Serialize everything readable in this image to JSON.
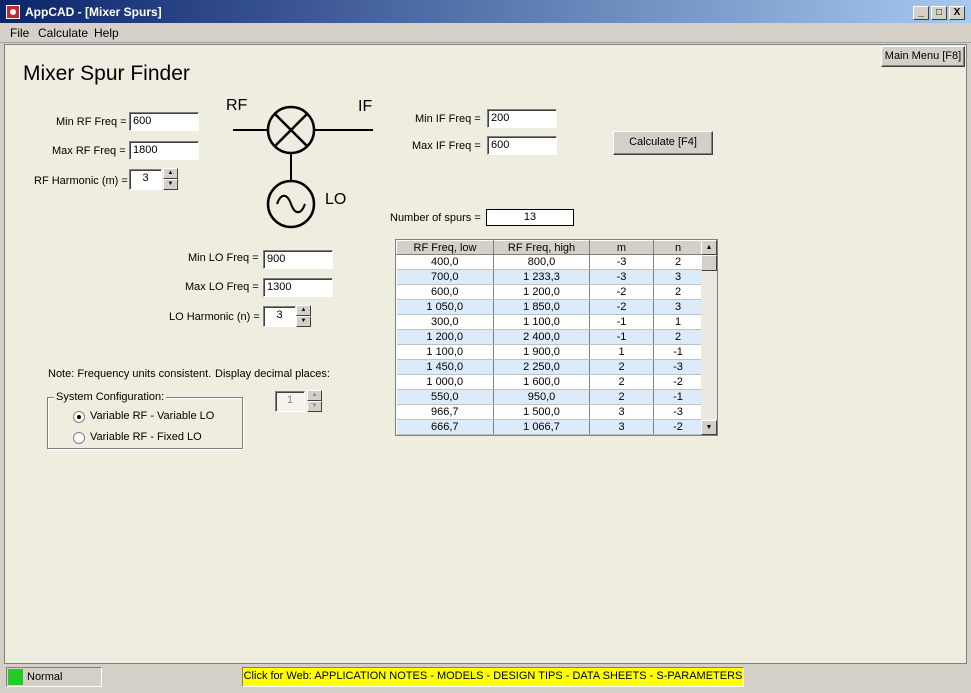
{
  "window": {
    "title": "AppCAD - [Mixer Spurs]",
    "btn_min": "_",
    "btn_max": "□",
    "btn_close": "X"
  },
  "menu": {
    "file": "File",
    "calculate": "Calculate",
    "help": "Help"
  },
  "main_menu_button": "Main Menu [F8]",
  "page_title": "Mixer Spur Finder",
  "rf": {
    "min_label": "Min RF Freq =",
    "min_value": "600",
    "max_label": "Max RF Freq =",
    "max_value": "1800",
    "harmonic_label": "RF Harmonic (m) =",
    "harmonic_value": "3"
  },
  "if": {
    "min_label": "Min IF Freq =",
    "min_value": "200",
    "max_label": "Max IF Freq =",
    "max_value": "600"
  },
  "lo": {
    "min_label": "Min LO Freq =",
    "min_value": "900",
    "max_label": "Max LO Freq =",
    "max_value": "1300",
    "harmonic_label": "LO Harmonic (n) =",
    "harmonic_value": "3"
  },
  "diagram": {
    "rf": "RF",
    "if": "IF",
    "lo": "LO"
  },
  "calculate_button": "Calculate  [F4]",
  "spurs": {
    "label": "Number of spurs =",
    "value": "13"
  },
  "table": {
    "headers": [
      "RF Freq, low",
      "RF Freq, high",
      "m",
      "n"
    ],
    "rows": [
      [
        "400,0",
        "800,0",
        "-3",
        "2"
      ],
      [
        "700,0",
        "1 233,3",
        "-3",
        "3"
      ],
      [
        "600,0",
        "1 200,0",
        "-2",
        "2"
      ],
      [
        "1 050,0",
        "1 850,0",
        "-2",
        "3"
      ],
      [
        "300,0",
        "1 100,0",
        "-1",
        "1"
      ],
      [
        "1 200,0",
        "2 400,0",
        "-1",
        "2"
      ],
      [
        "1 100,0",
        "1 900,0",
        "1",
        "-1"
      ],
      [
        "1 450,0",
        "2 250,0",
        "2",
        "-3"
      ],
      [
        "1 000,0",
        "1 600,0",
        "2",
        "-2"
      ],
      [
        "550,0",
        "950,0",
        "2",
        "-1"
      ],
      [
        "966,7",
        "1 500,0",
        "3",
        "-3"
      ],
      [
        "666,7",
        "1 066,7",
        "3",
        "-2"
      ]
    ]
  },
  "note": {
    "text": "Note: Frequency units consistent.",
    "decimal_label": "Display decimal places:",
    "decimal_value": "1"
  },
  "system_config": {
    "legend": "System Configuration:",
    "option1": "Variable RF - Variable LO",
    "option2": "Variable RF - Fixed LO",
    "selected": "Variable RF - Variable LO"
  },
  "status": {
    "mode": "Normal",
    "web_link": "Click for Web: APPLICATION NOTES - MODELS - DESIGN TIPS - DATA SHEETS - S-PARAMETERS"
  },
  "colors": {
    "title_bar": "#0a246a",
    "client_bg": "#eeeddf",
    "row_alt": "#dcebfa",
    "status_green": "#22cc22",
    "web_yellow": "#ffff00"
  }
}
